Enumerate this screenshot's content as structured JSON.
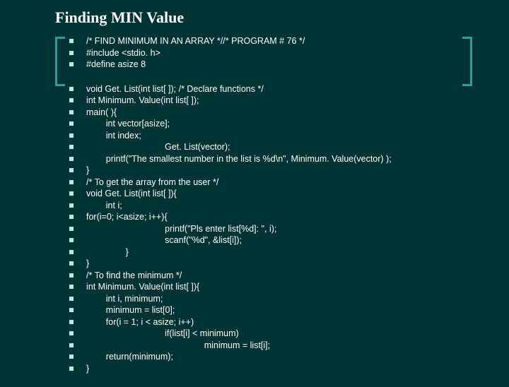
{
  "title": "Finding MIN Value",
  "block1": [
    "/* FIND MINIMUM IN AN ARRAY *//* PROGRAM # 76 */",
    "#include <stdio. h>",
    "#define asize 8"
  ],
  "block2": [
    "void Get. List(int list[ ]); /* Declare functions */",
    "int Minimum. Value(int list[ ]);",
    "main( ){",
    "        int vector[asize];",
    "        int index;",
    "                                Get. List(vector);",
    "        printf(\"The smallest number in the list is %d\\n\", Minimum. Value(vector) );",
    "}",
    "/* To get the array from the user */",
    "void Get. List(int list[ ]){",
    "        int i;",
    "for(i=0; i<asize; i++){",
    "                                printf(\"Pls enter list[%d]: \", i);",
    "                                scanf(\"%d\", &list[i]);",
    "                }",
    "}",
    "/* To find the minimum */",
    "int Minimum. Value(int list[ ]){",
    "        int i, minimum;",
    "        minimum = list[0];",
    "        for(i = 1; i < asize; i++)",
    "                                if(list[i] < minimum)",
    "                                                minimum = list[i];",
    "        return(minimum);",
    "}"
  ]
}
